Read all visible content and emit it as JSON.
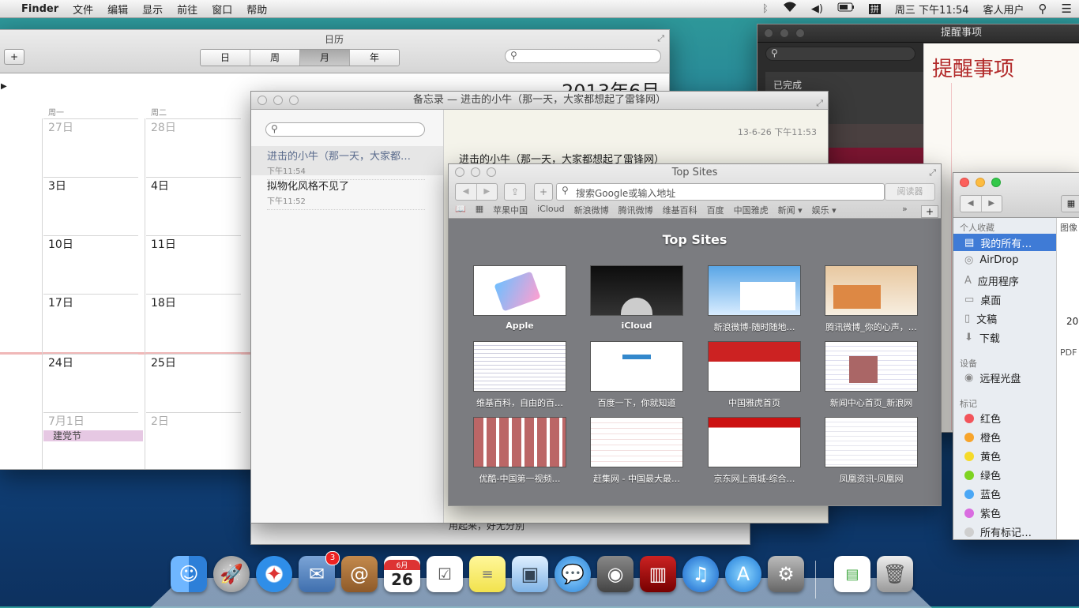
{
  "menubar": {
    "app": "Finder",
    "items": [
      "文件",
      "编辑",
      "显示",
      "前往",
      "窗口",
      "帮助"
    ],
    "clock": "周三 下午11:54",
    "user": "客人用户",
    "input_icon": "拼"
  },
  "calendar": {
    "title": "日历",
    "views": [
      "日",
      "周",
      "月",
      "年"
    ],
    "active_view": "月",
    "month_title": "2013年6月",
    "weekdays": [
      "周一",
      "周二"
    ],
    "weeks": [
      [
        "27日",
        "28日"
      ],
      [
        "3日",
        "4日"
      ],
      [
        "10日",
        "11日"
      ],
      [
        "17日",
        "18日"
      ],
      [
        "24日",
        "25日"
      ],
      [
        "7月1日",
        "2日"
      ]
    ],
    "event": "建党节"
  },
  "notes": {
    "title": "备忘录 — 进击的小牛（那一天，大家都想起了雷锋网）",
    "list": [
      {
        "title": "进击的小牛（那一天，大家都…",
        "time": "下午11:54"
      },
      {
        "title": "拟物化风格不见了",
        "time": "下午11:52"
      }
    ],
    "date": "13-6-26 下午11:53",
    "body": "进击的小牛（那一天，大家都想起了雷锋网）",
    "bottom_text": "用起来，好无分別"
  },
  "reminders": {
    "title": "提醒事项",
    "completed": "已完成",
    "list_title": "提醒事项"
  },
  "safari": {
    "title": "Top Sites",
    "address_placeholder": "搜索Google或输入地址",
    "reader": "阅读器",
    "bookmarks": [
      "苹果中国",
      "iCloud",
      "新浪微博",
      "腾讯微博",
      "维基百科",
      "百度",
      "中国雅虎",
      "新闻 ▾",
      "娱乐 ▾"
    ],
    "heading": "Top Sites",
    "sites": [
      "Apple",
      "iCloud",
      "新浪微博-随时随地…",
      "腾讯微博_你的心声，…",
      "维基百科，自由的百…",
      "百度一下，你就知道",
      "中国雅虎首页",
      "新闻中心首页_新浪网",
      "优酷-中国第一视频…",
      "赶集网 - 中国最大最…",
      "京东网上商城-综合…",
      "凤凰资讯-凤凰网"
    ]
  },
  "finder": {
    "favorites_header": "个人收藏",
    "favorites": [
      {
        "label": "我的所有…",
        "icon": "all-files-icon"
      },
      {
        "label": "AirDrop",
        "icon": "airdrop-icon"
      },
      {
        "label": "应用程序",
        "icon": "applications-icon"
      },
      {
        "label": "桌面",
        "icon": "desktop-icon"
      },
      {
        "label": "文稿",
        "icon": "documents-icon"
      },
      {
        "label": "下载",
        "icon": "downloads-icon"
      }
    ],
    "devices_header": "设备",
    "devices": [
      {
        "label": "远程光盘",
        "icon": "disc-icon"
      }
    ],
    "tags_header": "标记",
    "tags": [
      {
        "label": "红色",
        "color": "#f2545b"
      },
      {
        "label": "橙色",
        "color": "#f7a42b"
      },
      {
        "label": "黄色",
        "color": "#f5da2a"
      },
      {
        "label": "绿色",
        "color": "#7ed321"
      },
      {
        "label": "蓝色",
        "color": "#4aa7f5"
      },
      {
        "label": "紫色",
        "color": "#d96ce0"
      },
      {
        "label": "所有标记…",
        "color": "#cfcfcf"
      }
    ],
    "col_header": "图像",
    "col_value": "20",
    "col_pdf": "PDF"
  },
  "dock": {
    "badge": "3",
    "calendar_month": "6月",
    "calendar_day": "26",
    "icons": [
      "finder-icon",
      "launchpad-icon",
      "safari-icon",
      "mail-icon",
      "contacts-icon",
      "calendar-icon",
      "reminders-icon",
      "notes-icon",
      "preview-icon",
      "messages-icon",
      "facetime-icon",
      "photobooth-icon",
      "itunes-icon",
      "appstore-icon",
      "system-preferences-icon",
      "document-icon",
      "trash-icon"
    ]
  }
}
